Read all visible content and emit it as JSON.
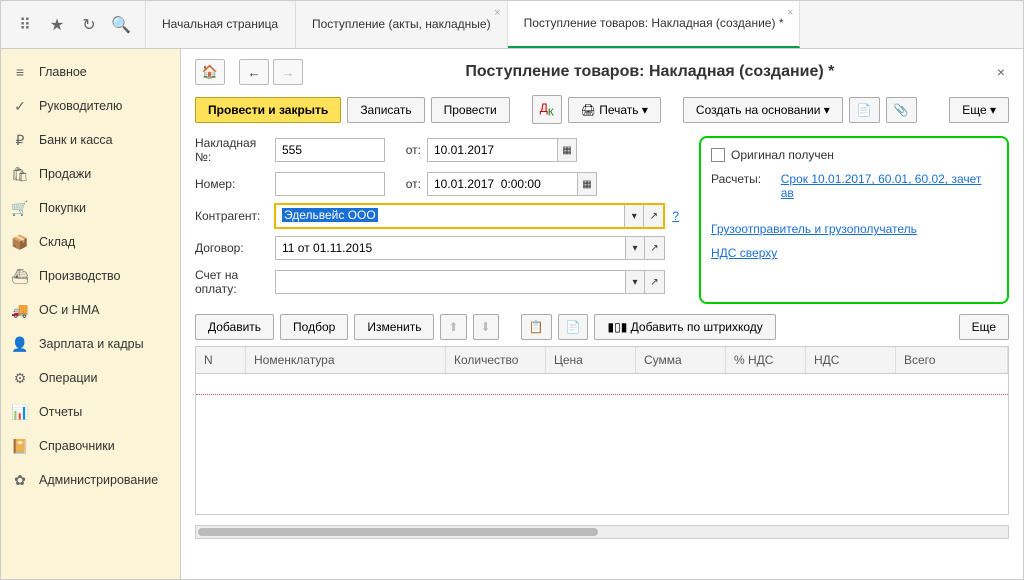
{
  "tabs": {
    "home": "Начальная страница",
    "receipts": "Поступление (акты, накладные)",
    "current": "Поступление товаров: Накладная (создание) *"
  },
  "sidebar": {
    "items": [
      {
        "label": "Главное",
        "icon": "≡"
      },
      {
        "label": "Руководителю",
        "icon": "✓"
      },
      {
        "label": "Банк и касса",
        "icon": "₽"
      },
      {
        "label": "Продажи",
        "icon": "🛍"
      },
      {
        "label": "Покупки",
        "icon": "🛒"
      },
      {
        "label": "Склад",
        "icon": "📦"
      },
      {
        "label": "Производство",
        "icon": "⛴"
      },
      {
        "label": "ОС и НМА",
        "icon": "🚚"
      },
      {
        "label": "Зарплата и кадры",
        "icon": "👤"
      },
      {
        "label": "Операции",
        "icon": "⚙"
      },
      {
        "label": "Отчеты",
        "icon": "📊"
      },
      {
        "label": "Справочники",
        "icon": "📔"
      },
      {
        "label": "Администрирование",
        "icon": "✿"
      }
    ]
  },
  "page": {
    "title": "Поступление товаров: Накладная (создание) *"
  },
  "toolbar": {
    "post_close": "Провести и закрыть",
    "save": "Записать",
    "post": "Провести",
    "print": "Печать",
    "create_based": "Создать на основании",
    "more": "Еще"
  },
  "form": {
    "invoice_no_label": "Накладная №:",
    "invoice_no": "555",
    "from_label": "от:",
    "invoice_date": "10.01.2017",
    "number_label": "Номер:",
    "number": "",
    "number_date": "10.01.2017  0:00:00",
    "counterparty_label": "Контрагент:",
    "counterparty": "Эдельвейс ООО",
    "contract_label": "Договор:",
    "contract": "11 от 01.11.2015",
    "payment_acc_label": "Счет на оплату:",
    "payment_acc": ""
  },
  "right": {
    "original_received": "Оригинал получен",
    "settlements_label": "Расчеты:",
    "settlements_link": "Срок 10.01.2017, 60.01, 60.02, зачет ав",
    "shipper_link": "Грузоотправитель и грузополучатель",
    "vat_link": "НДС сверху"
  },
  "subtoolbar": {
    "add": "Добавить",
    "pick": "Подбор",
    "edit": "Изменить",
    "barcode": "Добавить по штрихкоду",
    "more2": "Еще"
  },
  "table": {
    "cols": [
      "N",
      "Номенклатура",
      "Количество",
      "Цена",
      "Сумма",
      "% НДС",
      "НДС",
      "Всего"
    ]
  }
}
